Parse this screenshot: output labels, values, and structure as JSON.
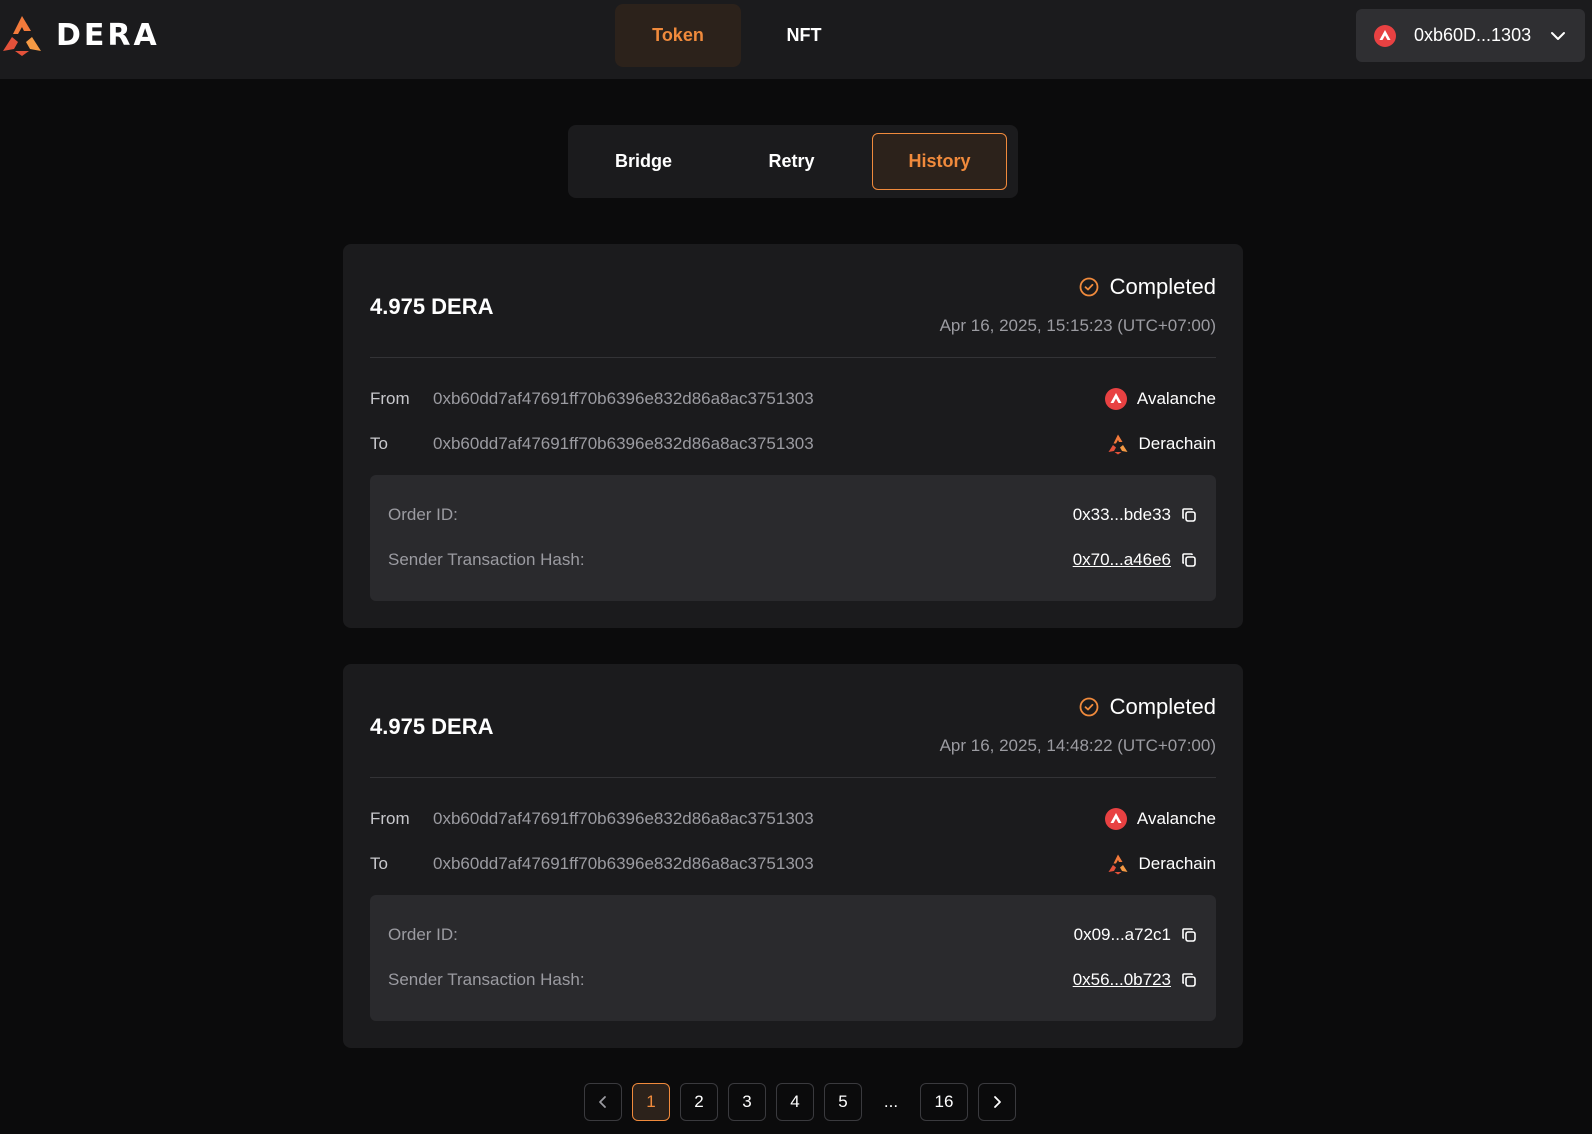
{
  "brand": {
    "name": "DERA",
    "accent": "#f08a3c"
  },
  "main_tabs": [
    {
      "label": "Token",
      "active": true
    },
    {
      "label": "NFT",
      "active": false
    }
  ],
  "wallet": {
    "address": "0xb60D...1303",
    "chain_icon": "avalanche-icon"
  },
  "sub_tabs": [
    {
      "label": "Bridge",
      "active": false
    },
    {
      "label": "Retry",
      "active": false
    },
    {
      "label": "History",
      "active": true
    }
  ],
  "history": [
    {
      "amount": "4.975 DERA",
      "status": "Completed",
      "time": "Apr 16, 2025, 15:15:23 (UTC+07:00)",
      "from_label": "From",
      "from_address": "0xb60dd7af47691ff70b6396e832d86a8ac3751303",
      "from_chain": "Avalanche",
      "to_label": "To",
      "to_address": "0xb60dd7af47691ff70b6396e832d86a8ac3751303",
      "to_chain": "Derachain",
      "order_id_label": "Order ID:",
      "order_id": "0x33...bde33",
      "tx_hash_label": "Sender Transaction Hash:",
      "tx_hash": "0x70...a46e6"
    },
    {
      "amount": "4.975 DERA",
      "status": "Completed",
      "time": "Apr 16, 2025, 14:48:22 (UTC+07:00)",
      "from_label": "From",
      "from_address": "0xb60dd7af47691ff70b6396e832d86a8ac3751303",
      "from_chain": "Avalanche",
      "to_label": "To",
      "to_address": "0xb60dd7af47691ff70b6396e832d86a8ac3751303",
      "to_chain": "Derachain",
      "order_id_label": "Order ID:",
      "order_id": "0x09...a72c1",
      "tx_hash_label": "Sender Transaction Hash:",
      "tx_hash": "0x56...0b723"
    }
  ],
  "pagination": {
    "prev_icon": "chevron-left-icon",
    "next_icon": "chevron-right-icon",
    "pages": [
      "1",
      "2",
      "3",
      "4",
      "5"
    ],
    "current": "1",
    "ellipsis": "...",
    "last": "16"
  }
}
